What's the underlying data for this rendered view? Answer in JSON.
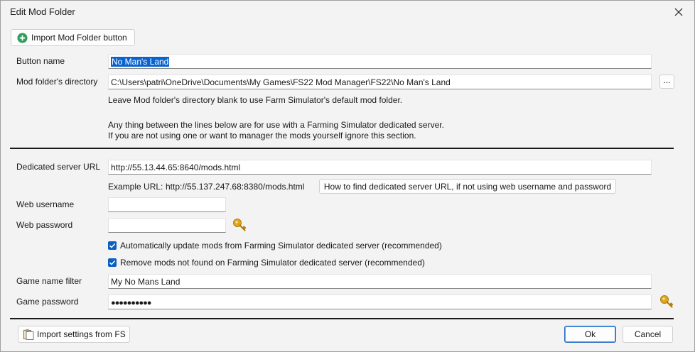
{
  "window": {
    "title": "Edit Mod Folder"
  },
  "import_button": {
    "label": "Import Mod Folder button"
  },
  "button_name": {
    "label": "Button name",
    "value": "No Man's Land"
  },
  "mod_dir": {
    "label": "Mod folder's directory",
    "value": "C:\\Users\\patri\\OneDrive\\Documents\\My Games\\FS22 Mod Manager\\FS22\\No Man's Land",
    "browse_label": "...",
    "hint": "Leave Mod folder's directory blank to use Farm Simulator's default mod folder."
  },
  "notes": {
    "line1": "Any thing between the lines below are for use with a Farming Simulator dedicated server.",
    "line2": "If you are not using one or want to manager the mods yourself ignore this section."
  },
  "server_url": {
    "label": "Dedicated server URL",
    "value": "http://55.13.44.65:8640/mods.html",
    "example_label": "Example URL:",
    "example_value": "http://55.137.247.68:8380/mods.html",
    "help_button": "How to find dedicated server URL, if not using web username and password"
  },
  "web_username": {
    "label": "Web username",
    "value": ""
  },
  "web_password": {
    "label": "Web password",
    "value": ""
  },
  "checkboxes": [
    {
      "label": "Automatically update mods from Farming Simulator dedicated server (recommended)",
      "checked": true
    },
    {
      "label": "Remove mods not found on Farming Simulator dedicated server (recommended)",
      "checked": true
    }
  ],
  "game_name": {
    "label": "Game name filter",
    "value": "My No Mans Land"
  },
  "game_password": {
    "label": "Game password",
    "value": "●●●●●●●●●●"
  },
  "footer": {
    "import_fs_label": "Import settings from FS",
    "ok_label": "Ok",
    "cancel_label": "Cancel"
  },
  "colors": {
    "accent": "#0a5fc2",
    "add_icon": "#2e9e5a",
    "key_icon": "#e0a81e"
  }
}
